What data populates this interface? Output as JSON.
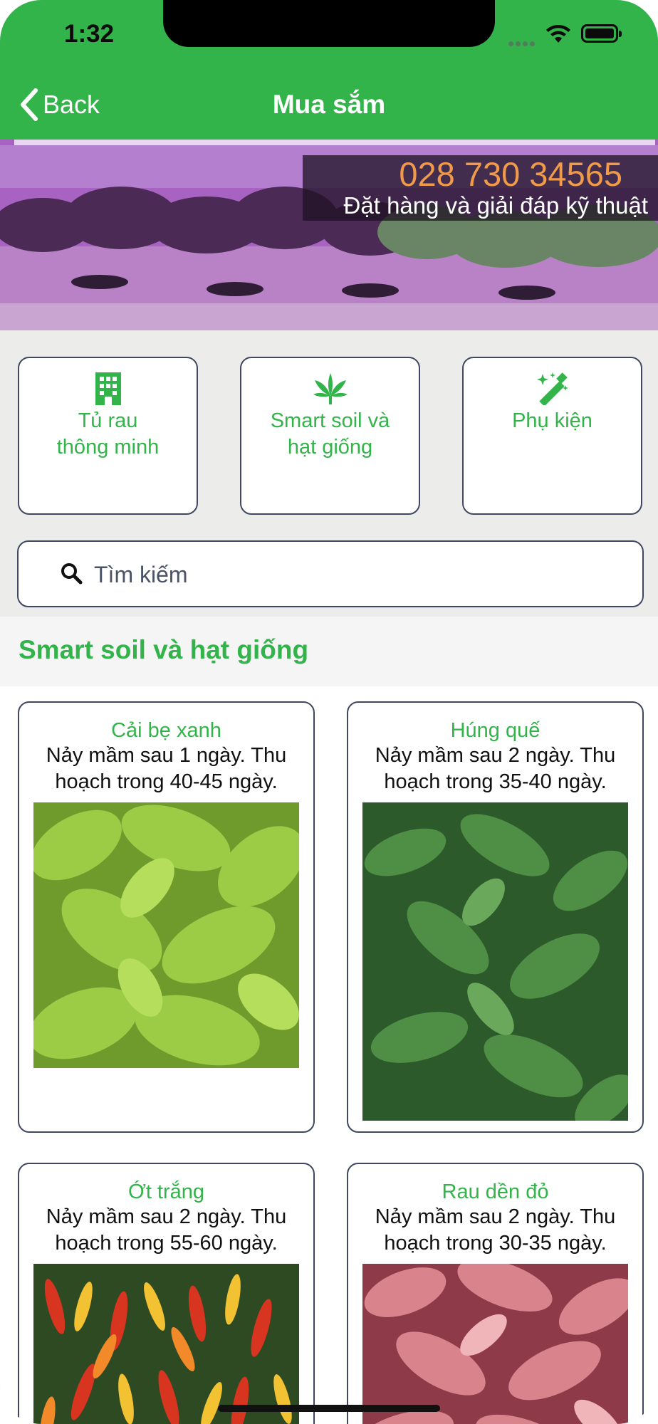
{
  "status_bar": {
    "time": "1:32"
  },
  "nav": {
    "back_label": "Back",
    "title": "Mua sắm"
  },
  "banner": {
    "phone": "028 730 34565",
    "tagline": "Đặt hàng và giải đáp kỹ thuật"
  },
  "categories": [
    {
      "label": "Tủ rau\nthông minh",
      "icon": "building-icon"
    },
    {
      "label": "Smart soil và\nhạt giống",
      "icon": "cannabis-leaf-icon"
    },
    {
      "label": "Phụ kiện",
      "icon": "magic-wand-icon"
    }
  ],
  "search": {
    "placeholder": "Tìm kiếm"
  },
  "section": {
    "title": "Smart soil và hạt giống"
  },
  "products": [
    {
      "name": "Cải bẹ xanh",
      "desc": "Nảy mầm sau 1 ngày. Thu hoạch trong 40-45 ngày."
    },
    {
      "name": "Húng quế",
      "desc": "Nảy mầm sau 2 ngày. Thu hoạch trong 35-40 ngày."
    },
    {
      "name": "Ớt trắng",
      "desc": "Nảy mầm sau 2 ngày. Thu hoạch trong 55-60 ngày."
    },
    {
      "name": "Rau dền đỏ",
      "desc": "Nảy mầm sau 2 ngày. Thu hoạch trong 30-35 ngày."
    }
  ],
  "colors": {
    "brand_green": "#33b44a",
    "border": "#3f4860",
    "phone_orange": "#f09a4a"
  }
}
